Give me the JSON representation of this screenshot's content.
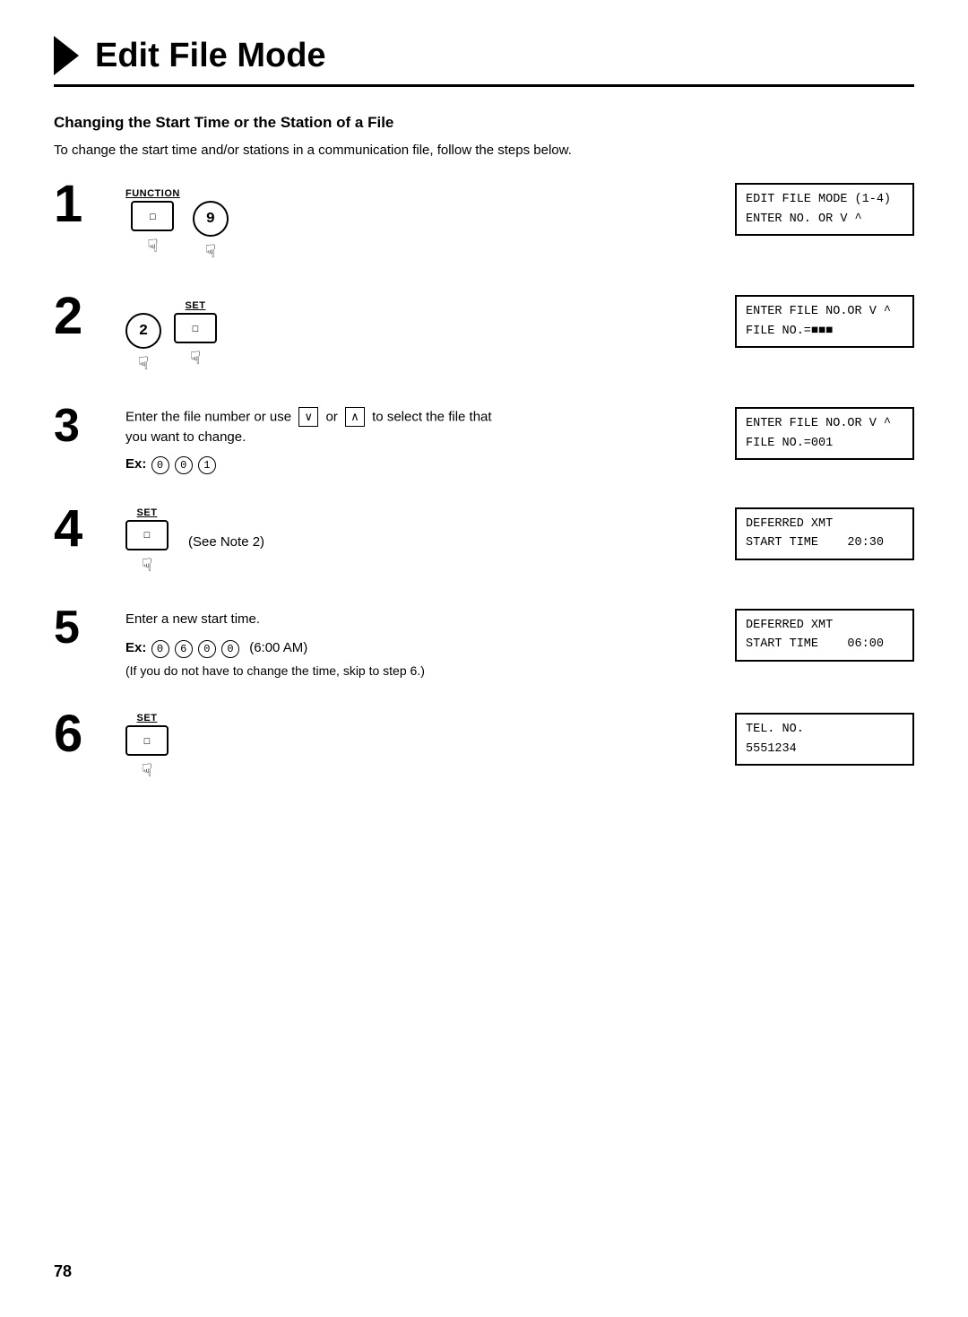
{
  "page": {
    "title": "Edit File Mode",
    "section_heading": "Changing the Start Time or the Station of a File",
    "intro": "To change the start time and/or stations in a communication file, follow the steps below.",
    "page_number": "78"
  },
  "steps": [
    {
      "number": "1",
      "keys": [
        "FUNCTION",
        "9"
      ],
      "display_lines": [
        "EDIT FILE MODE (1-4)",
        "ENTER NO. OR V ^"
      ]
    },
    {
      "number": "2",
      "keys": [
        "2",
        "SET"
      ],
      "display_lines": [
        "ENTER FILE NO.OR V ^",
        "FILE NO.=■■■"
      ]
    },
    {
      "number": "3",
      "instruction": "Enter the file number or use",
      "instruction2": "you want to change.",
      "ex_label": "Ex:",
      "ex_keys": [
        "0",
        "0",
        "1"
      ],
      "display_lines": [
        "ENTER FILE NO.OR V ^",
        "FILE NO.=001"
      ]
    },
    {
      "number": "4",
      "keys": [
        "SET"
      ],
      "note": "(See Note 2)",
      "display_lines": [
        "DEFERRED XMT",
        "START TIME    20:30"
      ]
    },
    {
      "number": "5",
      "instruction": "Enter a new start time.",
      "ex_label": "Ex:",
      "ex_keys": [
        "0",
        "6",
        "0",
        "0"
      ],
      "ex_extra": "(6:00 AM)",
      "ex_note": "(If you do not have to change the time, skip to step 6.)",
      "display_lines": [
        "DEFERRED XMT",
        "START TIME    06:00"
      ]
    },
    {
      "number": "6",
      "keys": [
        "SET"
      ],
      "display_lines": [
        "TEL. NO.",
        "5551234"
      ]
    }
  ],
  "icons": {
    "function_label": "FUNCTION",
    "set_label": "SET",
    "v_down": "∨",
    "v_up": "∧",
    "finger": "☟"
  }
}
